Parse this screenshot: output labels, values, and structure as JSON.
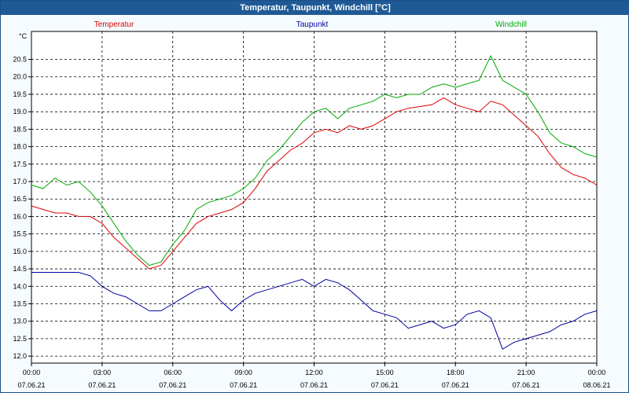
{
  "window": {
    "title": "Temperatur, Taupunkt, Windchill [°C]"
  },
  "chart_data": {
    "type": "line",
    "title": "Temperatur, Taupunkt, Windchill [°C]",
    "ylabel": "°C",
    "ylim": [
      11.8,
      21.3
    ],
    "xlim_hours": [
      0,
      24
    ],
    "grid": true,
    "legend_position": "top",
    "y_ticks": [
      "12.0",
      "12.5",
      "13.0",
      "13.5",
      "14.0",
      "14.5",
      "15.0",
      "15.5",
      "16.0",
      "16.5",
      "17.0",
      "17.5",
      "18.0",
      "18.5",
      "19.0",
      "19.5",
      "20.0",
      "20.5"
    ],
    "x_ticks": [
      {
        "time": "00:00",
        "date": "07.06.21"
      },
      {
        "time": "03:00",
        "date": "07.06.21"
      },
      {
        "time": "06:00",
        "date": "07.06.21"
      },
      {
        "time": "09:00",
        "date": "07.06.21"
      },
      {
        "time": "12:00",
        "date": "07.06.21"
      },
      {
        "time": "15:00",
        "date": "07.06.21"
      },
      {
        "time": "18:00",
        "date": "07.06.21"
      },
      {
        "time": "21:00",
        "date": "07.06.21"
      },
      {
        "time": "00:00",
        "date": "08.06.21"
      }
    ],
    "series": [
      {
        "name": "Temperatur",
        "color": "#dd0000",
        "points": [
          [
            0,
            16.3
          ],
          [
            0.5,
            16.2
          ],
          [
            1,
            16.1
          ],
          [
            1.5,
            16.1
          ],
          [
            2,
            16.0
          ],
          [
            2.5,
            16.0
          ],
          [
            3,
            15.8
          ],
          [
            3.5,
            15.4
          ],
          [
            4,
            15.1
          ],
          [
            4.5,
            14.8
          ],
          [
            5,
            14.5
          ],
          [
            5.5,
            14.6
          ],
          [
            6,
            15.0
          ],
          [
            6.5,
            15.4
          ],
          [
            7,
            15.8
          ],
          [
            7.5,
            16.0
          ],
          [
            8,
            16.1
          ],
          [
            8.5,
            16.2
          ],
          [
            9,
            16.4
          ],
          [
            9.5,
            16.8
          ],
          [
            10,
            17.3
          ],
          [
            10.5,
            17.6
          ],
          [
            11,
            17.9
          ],
          [
            11.5,
            18.1
          ],
          [
            12,
            18.4
          ],
          [
            12.5,
            18.5
          ],
          [
            13,
            18.4
          ],
          [
            13.5,
            18.6
          ],
          [
            14,
            18.5
          ],
          [
            14.5,
            18.6
          ],
          [
            15,
            18.8
          ],
          [
            15.5,
            19.0
          ],
          [
            16,
            19.1
          ],
          [
            16.5,
            19.15
          ],
          [
            17,
            19.2
          ],
          [
            17.5,
            19.4
          ],
          [
            18,
            19.2
          ],
          [
            18.5,
            19.1
          ],
          [
            19,
            19.0
          ],
          [
            19.5,
            19.3
          ],
          [
            20,
            19.2
          ],
          [
            20.5,
            18.9
          ],
          [
            21,
            18.6
          ],
          [
            21.5,
            18.3
          ],
          [
            22,
            17.8
          ],
          [
            22.5,
            17.4
          ],
          [
            23,
            17.2
          ],
          [
            23.5,
            17.1
          ],
          [
            24,
            16.9
          ]
        ]
      },
      {
        "name": "Taupunkt",
        "color": "#00009a",
        "points": [
          [
            0,
            14.4
          ],
          [
            0.5,
            14.4
          ],
          [
            1,
            14.4
          ],
          [
            1.5,
            14.4
          ],
          [
            2,
            14.4
          ],
          [
            2.5,
            14.3
          ],
          [
            3,
            14.0
          ],
          [
            3.5,
            13.8
          ],
          [
            4,
            13.7
          ],
          [
            4.5,
            13.5
          ],
          [
            5,
            13.3
          ],
          [
            5.5,
            13.3
          ],
          [
            6,
            13.5
          ],
          [
            6.5,
            13.7
          ],
          [
            7,
            13.9
          ],
          [
            7.5,
            14.0
          ],
          [
            8,
            13.6
          ],
          [
            8.5,
            13.3
          ],
          [
            9,
            13.6
          ],
          [
            9.5,
            13.8
          ],
          [
            10,
            13.9
          ],
          [
            10.5,
            14.0
          ],
          [
            11,
            14.1
          ],
          [
            11.5,
            14.2
          ],
          [
            12,
            14.0
          ],
          [
            12.5,
            14.2
          ],
          [
            13,
            14.1
          ],
          [
            13.5,
            13.9
          ],
          [
            14,
            13.6
          ],
          [
            14.5,
            13.3
          ],
          [
            15,
            13.2
          ],
          [
            15.5,
            13.1
          ],
          [
            16,
            12.8
          ],
          [
            16.5,
            12.9
          ],
          [
            17,
            13.0
          ],
          [
            17.5,
            12.8
          ],
          [
            18,
            12.9
          ],
          [
            18.5,
            13.2
          ],
          [
            19,
            13.3
          ],
          [
            19.5,
            13.1
          ],
          [
            20,
            12.2
          ],
          [
            20.5,
            12.4
          ],
          [
            21,
            12.5
          ],
          [
            21.5,
            12.6
          ],
          [
            22,
            12.7
          ],
          [
            22.5,
            12.9
          ],
          [
            23,
            13.0
          ],
          [
            23.5,
            13.2
          ],
          [
            24,
            13.3
          ]
        ]
      },
      {
        "name": "Windchill",
        "color": "#00aa00",
        "points": [
          [
            0,
            16.9
          ],
          [
            0.5,
            16.8
          ],
          [
            1,
            17.1
          ],
          [
            1.5,
            16.9
          ],
          [
            2,
            17.0
          ],
          [
            2.5,
            16.7
          ],
          [
            3,
            16.3
          ],
          [
            3.5,
            15.8
          ],
          [
            4,
            15.3
          ],
          [
            4.5,
            14.9
          ],
          [
            5,
            14.6
          ],
          [
            5.5,
            14.7
          ],
          [
            6,
            15.2
          ],
          [
            6.5,
            15.6
          ],
          [
            7,
            16.2
          ],
          [
            7.5,
            16.4
          ],
          [
            8,
            16.5
          ],
          [
            8.5,
            16.6
          ],
          [
            9,
            16.8
          ],
          [
            9.5,
            17.1
          ],
          [
            10,
            17.6
          ],
          [
            10.5,
            17.9
          ],
          [
            11,
            18.3
          ],
          [
            11.5,
            18.7
          ],
          [
            12,
            19.0
          ],
          [
            12.5,
            19.1
          ],
          [
            13,
            18.8
          ],
          [
            13.5,
            19.1
          ],
          [
            14,
            19.2
          ],
          [
            14.5,
            19.3
          ],
          [
            15,
            19.5
          ],
          [
            15.5,
            19.4
          ],
          [
            16,
            19.5
          ],
          [
            16.5,
            19.5
          ],
          [
            17,
            19.7
          ],
          [
            17.5,
            19.8
          ],
          [
            18,
            19.7
          ],
          [
            18.5,
            19.8
          ],
          [
            19,
            19.9
          ],
          [
            19.5,
            20.6
          ],
          [
            20,
            19.9
          ],
          [
            20.5,
            19.7
          ],
          [
            21,
            19.5
          ],
          [
            21.5,
            19.0
          ],
          [
            22,
            18.4
          ],
          [
            22.5,
            18.1
          ],
          [
            23,
            18.0
          ],
          [
            23.5,
            17.8
          ],
          [
            24,
            17.7
          ]
        ]
      }
    ]
  }
}
